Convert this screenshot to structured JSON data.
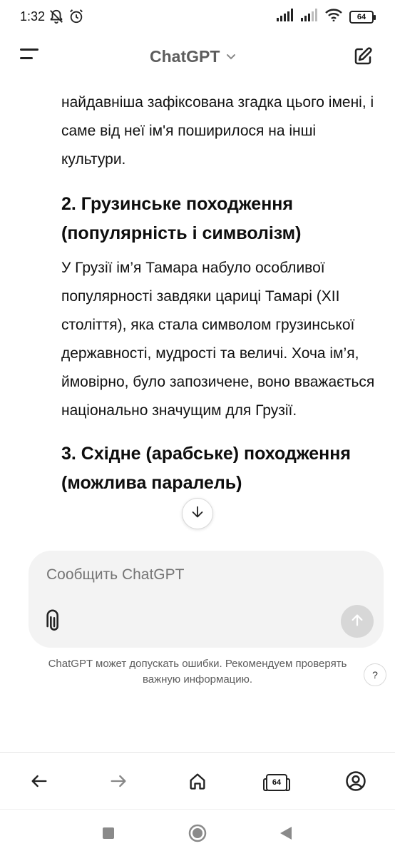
{
  "status_bar": {
    "time": "1:32",
    "battery": "64",
    "icons": [
      "mute-notifications-icon",
      "alarm-icon",
      "signal-icon",
      "signal-icon",
      "wifi-icon",
      "battery-icon"
    ]
  },
  "header": {
    "title": "ChatGPT",
    "icons": [
      "menu-icon",
      "chevron-down-icon",
      "new-chat-icon"
    ]
  },
  "chat": {
    "paragraph_1": "найдавніша зафіксована згадка цього імені, і саме від неї ім'я поширилося на інші культури.",
    "heading_2": "2. Грузинське походження (популярність і символізм)",
    "paragraph_2": "У Грузії ім’я Тамара набуло особливої популярності завдяки цариці Тамарі (XII століття), яка стала символом грузинської державності, мудрості та величі. Хоча ім’я, ймовірно, було запозичене, воно вважається національно значущим для Грузії.",
    "heading_3": "3. Східне (арабське) походження (можлива паралель)"
  },
  "composer": {
    "placeholder": "Сообщить ChatGPT"
  },
  "disclaimer": {
    "line_1": "ChatGPT может допускать ошибки. Рекомендуем проверять",
    "line_2": "важную информацию.",
    "help_label": "?"
  },
  "browser_bar": {
    "tab_count": "64",
    "icons": [
      "back-arrow-icon",
      "forward-arrow-icon",
      "home-icon",
      "tabs-icon",
      "account-icon"
    ]
  },
  "system_nav": {
    "icons": [
      "recents-square-icon",
      "home-circle-icon",
      "back-triangle-icon"
    ]
  },
  "colors": {
    "text": "#0d0d0d",
    "muted": "#5d5d5d",
    "composer_bg": "#f3f3f3",
    "send_disabled": "#d7d7d7"
  }
}
